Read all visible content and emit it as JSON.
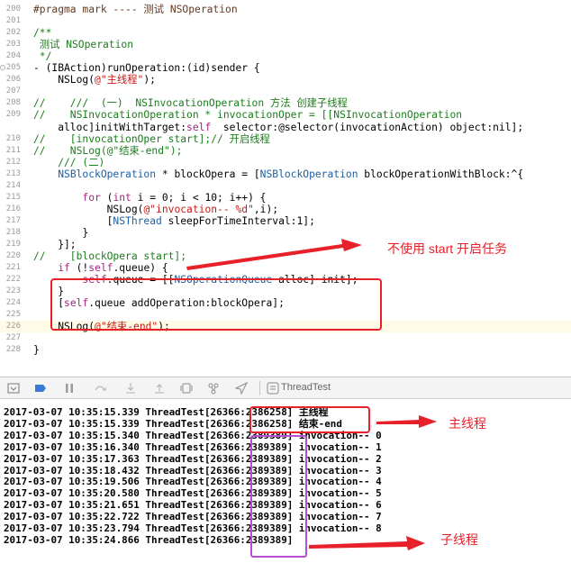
{
  "editor": {
    "lines": [
      {
        "no": "200",
        "code": "#pragma mark ---- 测试 NSOperation"
      },
      {
        "no": "201",
        "code": ""
      },
      {
        "no": "202",
        "code": "/**"
      },
      {
        "no": "203",
        "code": " 测试 NSOperation"
      },
      {
        "no": "204",
        "code": " */"
      },
      {
        "no": "205",
        "code": "- (IBAction)runOperation:(id)sender {"
      },
      {
        "no": "206",
        "code": "    NSLog(@\"主线程\");"
      },
      {
        "no": "207",
        "code": ""
      },
      {
        "no": "208",
        "code": "//    ///  (一)  NSInvocationOperation 方法 创建子线程"
      },
      {
        "no": "209",
        "code": "//    NSInvocationOperation * invocationOper = [[NSInvocationOperation"
      },
      {
        "no": "",
        "code": "    alloc]initWithTarget:self  selector:@selector(invocationAction) object:nil];"
      },
      {
        "no": "210",
        "code": "//    [invocationOper start];// 开启线程"
      },
      {
        "no": "211",
        "code": "//    NSLog(@\"结束-end\");"
      },
      {
        "no": "212",
        "code": "    /// (二)"
      },
      {
        "no": "213",
        "code": "    NSBlockOperation * blockOpera = [NSBlockOperation blockOperationWithBlock:^{"
      },
      {
        "no": "214",
        "code": ""
      },
      {
        "no": "215",
        "code": "        for (int i = 0; i < 10; i++) {"
      },
      {
        "no": "216",
        "code": "            NSLog(@\"invocation-- %d\",i);"
      },
      {
        "no": "217",
        "code": "            [NSThread sleepForTimeInterval:1];"
      },
      {
        "no": "218",
        "code": "        }"
      },
      {
        "no": "219",
        "code": "    }];"
      },
      {
        "no": "220",
        "code": "//    [blockOpera start];"
      },
      {
        "no": "221",
        "code": "    if (!self.queue) {"
      },
      {
        "no": "222",
        "code": "        self.queue = [[NSOperationQueue alloc] init];"
      },
      {
        "no": "223",
        "code": "    }"
      },
      {
        "no": "224",
        "code": "    [self.queue addOperation:blockOpera];"
      },
      {
        "no": "225",
        "code": ""
      },
      {
        "no": "226",
        "code": "    NSLog(@\"结束-end\");"
      },
      {
        "no": "227",
        "code": ""
      },
      {
        "no": "228",
        "code": "}"
      }
    ]
  },
  "toolbar": {
    "target_label": "ThreadTest"
  },
  "console": {
    "rows": [
      {
        "date": "2017-03-07",
        "time": "10:35:15.339",
        "proc": "ThreadTest[26366:",
        "tid": "2386258",
        "msg": "] 主线程"
      },
      {
        "date": "2017-03-07",
        "time": "10:35:15.339",
        "proc": "ThreadTest[26366:",
        "tid": "2386258",
        "msg": "] 结束-end"
      },
      {
        "date": "2017-03-07",
        "time": "10:35:15.340",
        "proc": "ThreadTest[26366:",
        "tid": "2389389",
        "msg": "] invocation-- 0"
      },
      {
        "date": "2017-03-07",
        "time": "10:35:16.340",
        "proc": "ThreadTest[26366:",
        "tid": "2389389",
        "msg": "] invocation-- 1"
      },
      {
        "date": "2017-03-07",
        "time": "10:35:17.363",
        "proc": "ThreadTest[26366:",
        "tid": "2389389",
        "msg": "] invocation-- 2"
      },
      {
        "date": "2017-03-07",
        "time": "10:35:18.432",
        "proc": "ThreadTest[26366:",
        "tid": "2389389",
        "msg": "] invocation-- 3"
      },
      {
        "date": "2017-03-07",
        "time": "10:35:19.506",
        "proc": "ThreadTest[26366:",
        "tid": "2389389",
        "msg": "] invocation-- 4"
      },
      {
        "date": "2017-03-07",
        "time": "10:35:20.580",
        "proc": "ThreadTest[26366:",
        "tid": "2389389",
        "msg": "] invocation-- 5"
      },
      {
        "date": "2017-03-07",
        "time": "10:35:21.651",
        "proc": "ThreadTest[26366:",
        "tid": "2389389",
        "msg": "] invocation-- 6"
      },
      {
        "date": "2017-03-07",
        "time": "10:35:22.722",
        "proc": "ThreadTest[26366:",
        "tid": "2389389",
        "msg": "] invocation-- 7"
      },
      {
        "date": "2017-03-07",
        "time": "10:35:23.794",
        "proc": "ThreadTest[26366:",
        "tid": "2389389",
        "msg": "] invocation-- 8"
      },
      {
        "date": "2017-03-07",
        "time": "10:35:24.866",
        "proc": "ThreadTest[26366:",
        "tid": "2389389",
        "msg": "] "
      }
    ]
  },
  "annotations": {
    "no_start_note": "不使用 start 开启任务",
    "main_thread_note": "主线程",
    "sub_thread_note": "子线程",
    "red": "#e8202a",
    "purple": "#b64fcf"
  }
}
